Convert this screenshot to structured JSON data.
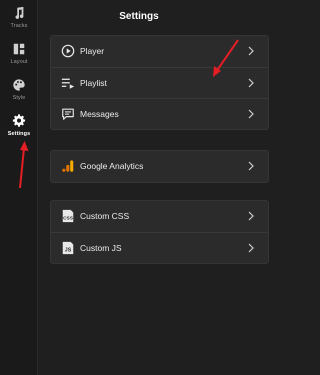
{
  "rail": {
    "items": [
      {
        "label": "Tracks",
        "icon": "music-note-icon"
      },
      {
        "label": "Layout",
        "icon": "layout-icon"
      },
      {
        "label": "Style",
        "icon": "palette-icon"
      },
      {
        "label": "Settings",
        "icon": "gear-icon",
        "active": true
      }
    ]
  },
  "page": {
    "title": "Settings"
  },
  "groups": [
    {
      "rows": [
        {
          "label": "Player",
          "icon": "play-circle-icon"
        },
        {
          "label": "Playlist",
          "icon": "playlist-icon"
        },
        {
          "label": "Messages",
          "icon": "message-icon"
        }
      ]
    },
    {
      "rows": [
        {
          "label": "Google Analytics",
          "icon": "analytics-icon"
        }
      ]
    },
    {
      "rows": [
        {
          "label": "Custom CSS",
          "icon": "css-icon"
        },
        {
          "label": "Custom JS",
          "icon": "js-icon"
        }
      ]
    }
  ],
  "colors": {
    "accent_arrow": "#e31e24",
    "analytics_orange": "#f9ab00"
  }
}
